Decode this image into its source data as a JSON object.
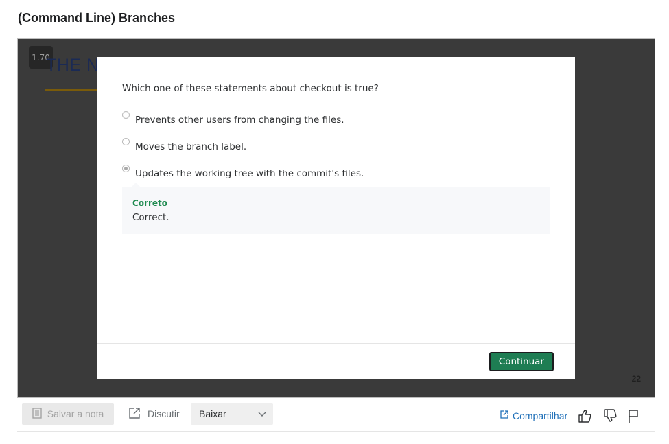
{
  "page": {
    "title": "(Command Line) Branches"
  },
  "video": {
    "speed": "1.70",
    "slide_heading": "THE N",
    "slide_number": "22"
  },
  "quiz": {
    "question": "Which one of these statements about checkout is true?",
    "options": [
      {
        "label": "Prevents other users from changing the files.",
        "selected": false
      },
      {
        "label": "Moves the branch label.",
        "selected": false
      },
      {
        "label": "Updates the working tree with the commit's files.",
        "selected": true
      }
    ],
    "feedback": {
      "title": "Correto",
      "text": "Correct."
    },
    "continue_label": "Continuar"
  },
  "toolbar": {
    "save_note_label": "Salvar a nota",
    "discuss_label": "Discutir",
    "download_label": "Baixar",
    "share_label": "Compartilhar"
  },
  "colors": {
    "accent_green": "#1e7d53",
    "link_blue": "#1f6fb8",
    "feedback_green": "#1e8a4f"
  }
}
